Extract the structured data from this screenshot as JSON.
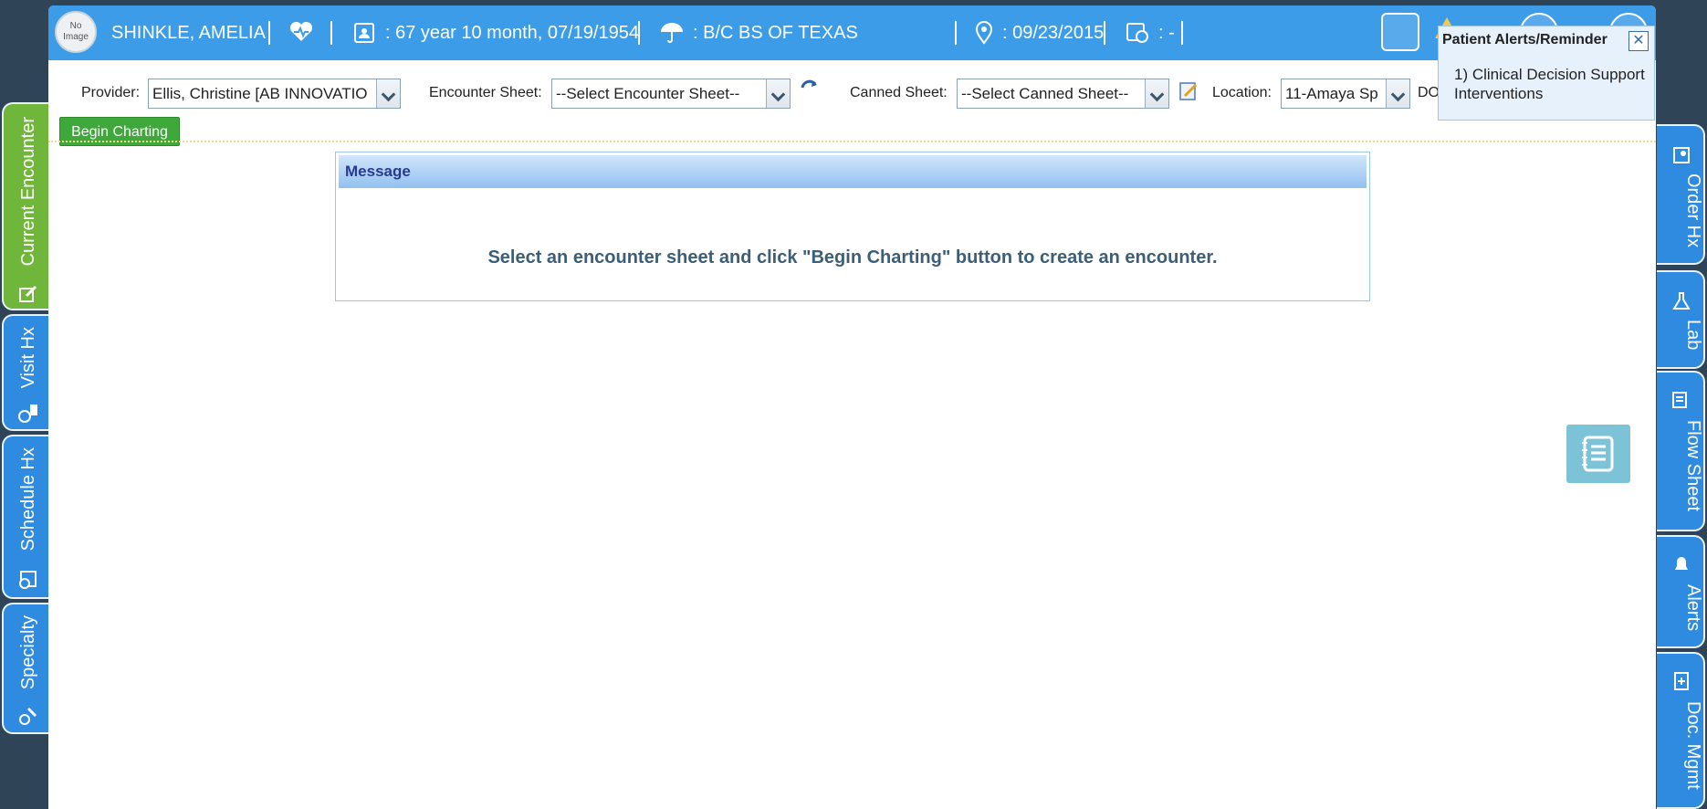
{
  "header": {
    "avatar_text": "No Image",
    "patient_name": "SHINKLE, AMELIA",
    "age_dob": ": 67 year 10 month, 07/19/1954",
    "insurance": ": B/C BS OF TEXAS",
    "last_visit": ": 09/23/2015",
    "appointment": ": -"
  },
  "toolbar": {
    "provider_label": "Provider:",
    "provider_value": "Ellis, Christine [AB INNOVATIO",
    "encounter_label": "Encounter Sheet:",
    "encounter_value": "--Select Encounter Sheet--",
    "canned_label": "Canned Sheet:",
    "canned_value": "--Select Canned Sheet--",
    "location_label": "Location:",
    "location_value": "11-Amaya Sp",
    "trailing_text": "DO",
    "begin_label": "Begin Charting"
  },
  "message": {
    "title": "Message",
    "text": "Select an encounter sheet and click \"Begin Charting\" button to create an encounter."
  },
  "alert_popup": {
    "title": "Patient Alerts/Reminder",
    "close": "✕",
    "item": "1) Clinical Decision Support Interventions"
  },
  "left_tabs": [
    "Current Encounter",
    "Visit Hx",
    "Schedule Hx",
    "Specialty"
  ],
  "right_tabs": [
    "Order Hx",
    "Lab",
    "Flow Sheet",
    "Alerts",
    "Doc. Mgmt"
  ],
  "colors": {
    "header_blue": "#3d9ce8",
    "active_tab_green": "#6fb63a",
    "tab_blue": "#2f8be0",
    "begin_green": "#3ea83a"
  }
}
